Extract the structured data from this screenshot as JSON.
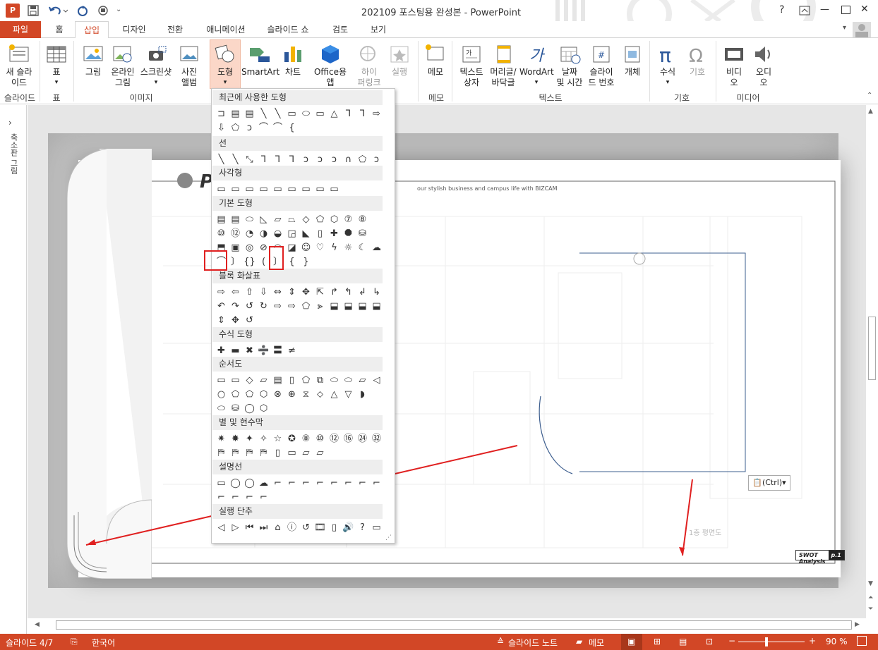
{
  "window": {
    "title": "202109 포스팅용 완성본 - PowerPoint",
    "help": "?",
    "min": "—",
    "close": "✕"
  },
  "tabs": [
    {
      "label": "파일"
    },
    {
      "label": "홈"
    },
    {
      "label": "삽입"
    },
    {
      "label": "디자인"
    },
    {
      "label": "전환"
    },
    {
      "label": "애니메이션"
    },
    {
      "label": "슬라이드 쇼"
    },
    {
      "label": "검토"
    },
    {
      "label": "보기"
    }
  ],
  "ribbon": {
    "new_slide": "새 슬라\n이드",
    "table": "표",
    "picture": "그림",
    "online_pic": "온라인\n그림",
    "screenshot": "스크린샷",
    "photo_album": "사진\n앨범",
    "shapes": "도형",
    "smartart": "SmartArt",
    "chart": "차트",
    "office_app": "Office용\n앱",
    "hyperlink": "하이\n퍼링크",
    "action": "실행",
    "memo": "메모",
    "textbox": "텍스트\n상자",
    "header_footer": "머리글/\n바닥글",
    "wordart": "WordArt",
    "date_time": "날짜\n및 시간",
    "slide_number": "슬라이\n드 번호",
    "object": "개체",
    "equation": "수식",
    "symbol": "기호",
    "video": "비디\n오",
    "audio": "오디\n오",
    "groups": {
      "slides": "슬라이드",
      "table": "표",
      "images": "이미지",
      "memo": "메모",
      "text": "텍스트",
      "symbols": "기호",
      "media": "미디어"
    }
  },
  "left_pane": {
    "label": "축소판 그림"
  },
  "gallery": {
    "sections": [
      {
        "title": "최근에 사용한 도형",
        "rows": [
          [
            "⊐",
            "▤",
            "▤",
            "╲",
            "╲",
            "▭",
            "⬭",
            "▭",
            "△",
            "⅂",
            "⅂",
            "⇨"
          ],
          [
            "⇩",
            "⬠",
            "ↄ",
            "⌒",
            "⌒",
            "{"
          ]
        ]
      },
      {
        "title": "선",
        "rows": [
          [
            "╲",
            "╲",
            "⤡",
            "⅂",
            "⅂",
            "⅂",
            "ↄ",
            "ↄ",
            "ↄ",
            "∩",
            "⬠",
            "ↄ"
          ]
        ]
      },
      {
        "title": "사각형",
        "rows": [
          [
            "▭",
            "▭",
            "▭",
            "▭",
            "▭",
            "▭",
            "▭",
            "▭",
            "▭"
          ]
        ]
      },
      {
        "title": "기본 도형",
        "rows": [
          [
            "▤",
            "▤",
            "⬭",
            "◺",
            "▱",
            "⏢",
            "◇",
            "⬠",
            "⬡",
            "⑦",
            "⑧"
          ],
          [
            "⑩",
            "⑫",
            "◔",
            "◑",
            "◒",
            "◲",
            "◣",
            "▯",
            "✚",
            "⯃",
            "⛁"
          ],
          [
            "⬒",
            "▣",
            "◎",
            "⊘",
            "◠",
            "◪",
            "☺",
            "♡",
            "ϟ",
            "☼",
            "☾",
            "☁"
          ],
          [
            "⌒",
            "〕",
            "{}",
            "(",
            "〕",
            "{",
            "}"
          ]
        ]
      },
      {
        "title": "블록 화살표",
        "rows": [
          [
            "⇨",
            "⇦",
            "⇧",
            "⇩",
            "⇔",
            "⇕",
            "✥",
            "⇱",
            "↱",
            "↰",
            "↲",
            "↳"
          ],
          [
            "↶",
            "↷",
            "↺",
            "↻",
            "⇨",
            "⇨",
            "⬠",
            "⪢",
            "⬓",
            "⬓",
            "⬓",
            "⬓"
          ],
          [
            "⇕",
            "✥",
            "↺"
          ]
        ]
      },
      {
        "title": "수식 도형",
        "rows": [
          [
            "✚",
            "▬",
            "✖",
            "➗",
            "〓",
            "≠"
          ]
        ]
      },
      {
        "title": "순서도",
        "rows": [
          [
            "▭",
            "▭",
            "◇",
            "▱",
            "▤",
            "▯",
            "⬠",
            "⧉",
            "⬭",
            "⬭",
            "▱",
            "◁"
          ],
          [
            "○",
            "⬠",
            "⬠",
            "⬡",
            "⊗",
            "⊕",
            "⧖",
            "⬦",
            "△",
            "▽",
            "◗"
          ],
          [
            "⬭",
            "⛁",
            "◯",
            "⬡"
          ]
        ]
      },
      {
        "title": "별 및 현수막",
        "rows": [
          [
            "✷",
            "✸",
            "✦",
            "✧",
            "☆",
            "✪",
            "⑧",
            "⑩",
            "⑫",
            "⑯",
            "㉔",
            "㉜"
          ],
          [
            "⛿",
            "⛿",
            "⛿",
            "⛿",
            "▯",
            "▭",
            "⏥",
            "⏥"
          ]
        ]
      },
      {
        "title": "설명선",
        "rows": [
          [
            "▭",
            "◯",
            "◯",
            "☁",
            "⌐",
            "⌐",
            "⌐",
            "⌐",
            "⌐",
            "⌐",
            "⌐",
            "⌐"
          ],
          [
            "⌐",
            "⌐",
            "⌐",
            "⌐"
          ]
        ]
      },
      {
        "title": "실행 단추",
        "rows": [
          [
            "◁",
            "▷",
            "⏮",
            "⏭",
            "⌂",
            "ⓘ",
            "↺",
            "🎞",
            "▯",
            "🔊",
            "?",
            "▭"
          ]
        ]
      }
    ]
  },
  "slide": {
    "title_text": "PPT",
    "subtitle": "our stylish business and campus life with BIZCAM",
    "badge": "SWOT Analysis",
    "page": "p.1",
    "plan_label": "1층 평면도"
  },
  "paste_tag": "(Ctrl)",
  "status": {
    "slide": "슬라이드 4/7",
    "lang": "한국어",
    "notes": "슬라이드 노트",
    "comments": "메모",
    "zoom": "90 %"
  },
  "colors": {
    "accent": "#d24726",
    "highlight": "#e02020"
  }
}
